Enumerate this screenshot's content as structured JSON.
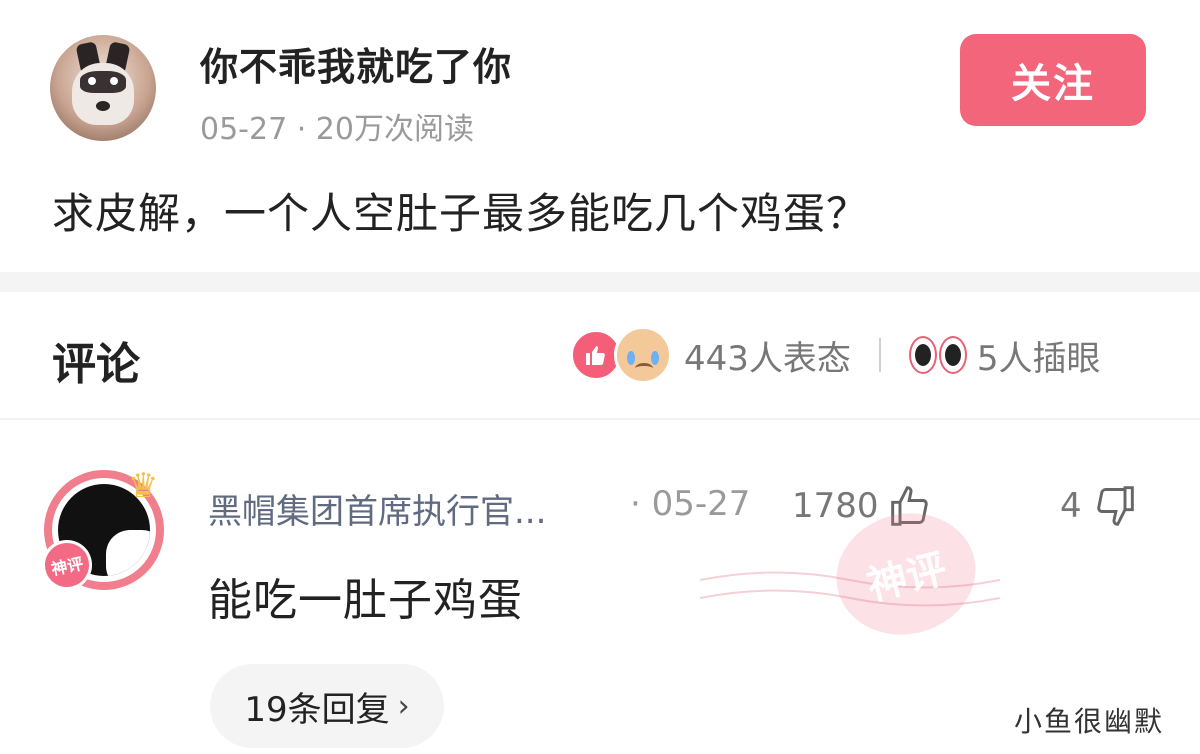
{
  "post": {
    "username": "你不乖我就吃了你",
    "meta": "05-27 · 20万次阅读",
    "follow_label": "关注",
    "question": "求皮解，一个人空肚子最多能吃几个鸡蛋？"
  },
  "comments_header": {
    "title": "评论",
    "reactions_count": "443人表态",
    "eye_count": "5人插眼"
  },
  "comment": {
    "author": "黑帽集团首席执行官...",
    "date": "· 05-27",
    "likes": "1780",
    "dislikes": "4",
    "text": "能吃一肚子鸡蛋",
    "badge": "神评",
    "stamp": "神评",
    "replies_label": "19条回复",
    "replies_arrow": "›"
  },
  "watermark": "小鱼很幽默",
  "colors": {
    "accent": "#f2657a",
    "muted": "#9a9a9a",
    "name": "#606a80"
  }
}
